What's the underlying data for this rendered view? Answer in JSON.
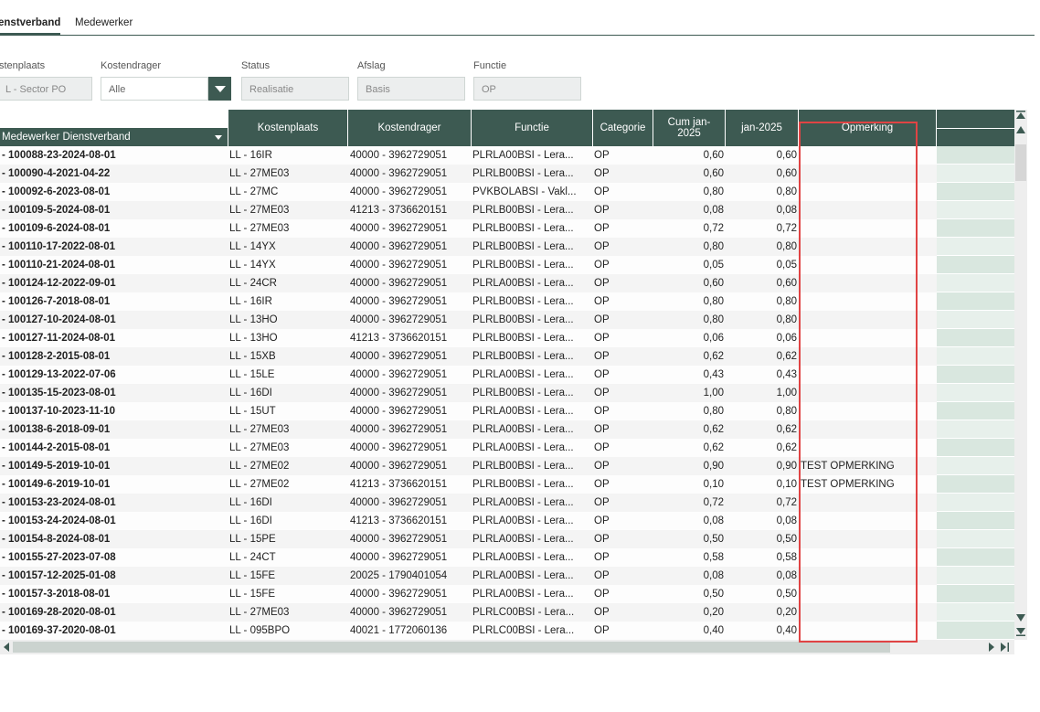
{
  "tabs": {
    "active": "enstverband",
    "second": "Medewerker"
  },
  "filters": [
    {
      "label": "stenplaats",
      "value": "L - Sector PO"
    },
    {
      "label": "Kostendrager",
      "value": "Alle"
    },
    {
      "label": "Status",
      "value": "Realisatie"
    },
    {
      "label": "Afslag",
      "value": "Basis"
    },
    {
      "label": "Functie",
      "value": "OP"
    }
  ],
  "table": {
    "headers": {
      "col1": "Medewerker Dienstverband",
      "col2": "Kostenplaats",
      "col3": "Kostendrager",
      "col4": "Functie",
      "col5": "Categorie",
      "col6": "Cum jan-\n2025",
      "col7": "jan-2025",
      "col8": "Opmerking"
    },
    "rows": [
      [
        "- 100088-23-2024-08-01",
        "LL - 16IR",
        "40000 - 3962729051",
        "PLRLA00BSI - Lera...",
        "OP",
        "0,60",
        "0,60",
        ""
      ],
      [
        "- 100090-4-2021-04-22",
        "LL - 27ME03",
        "40000 - 3962729051",
        "PLRLB00BSI - Lera...",
        "OP",
        "0,60",
        "0,60",
        ""
      ],
      [
        "- 100092-6-2023-08-01",
        "LL - 27MC",
        "40000 - 3962729051",
        "PVKBOLABSI - Vakl...",
        "OP",
        "0,80",
        "0,80",
        ""
      ],
      [
        "- 100109-5-2024-08-01",
        "LL - 27ME03",
        "41213 - 3736620151",
        "PLRLB00BSI - Lera...",
        "OP",
        "0,08",
        "0,08",
        ""
      ],
      [
        "- 100109-6-2024-08-01",
        "LL - 27ME03",
        "40000 - 3962729051",
        "PLRLB00BSI - Lera...",
        "OP",
        "0,72",
        "0,72",
        ""
      ],
      [
        "- 100110-17-2022-08-01",
        "LL - 14YX",
        "40000 - 3962729051",
        "PLRLB00BSI - Lera...",
        "OP",
        "0,80",
        "0,80",
        ""
      ],
      [
        "- 100110-21-2024-08-01",
        "LL - 14YX",
        "40000 - 3962729051",
        "PLRLB00BSI - Lera...",
        "OP",
        "0,05",
        "0,05",
        ""
      ],
      [
        "- 100124-12-2022-09-01",
        "LL - 24CR",
        "40000 - 3962729051",
        "PLRLA00BSI - Lera...",
        "OP",
        "0,60",
        "0,60",
        ""
      ],
      [
        "- 100126-7-2018-08-01",
        "LL - 16IR",
        "40000 - 3962729051",
        "PLRLB00BSI - Lera...",
        "OP",
        "0,80",
        "0,80",
        ""
      ],
      [
        "- 100127-10-2024-08-01",
        "LL - 13HO",
        "40000 - 3962729051",
        "PLRLB00BSI - Lera...",
        "OP",
        "0,80",
        "0,80",
        ""
      ],
      [
        "- 100127-11-2024-08-01",
        "LL - 13HO",
        "41213 - 3736620151",
        "PLRLB00BSI - Lera...",
        "OP",
        "0,06",
        "0,06",
        ""
      ],
      [
        "- 100128-2-2015-08-01",
        "LL - 15XB",
        "40000 - 3962729051",
        "PLRLB00BSI - Lera...",
        "OP",
        "0,62",
        "0,62",
        ""
      ],
      [
        "- 100129-13-2022-07-06",
        "LL - 15LE",
        "40000 - 3962729051",
        "PLRLA00BSI - Lera...",
        "OP",
        "0,43",
        "0,43",
        ""
      ],
      [
        "- 100135-15-2023-08-01",
        "LL - 16DI",
        "40000 - 3962729051",
        "PLRLB00BSI - Lera...",
        "OP",
        "1,00",
        "1,00",
        ""
      ],
      [
        "- 100137-10-2023-11-10",
        "LL - 15UT",
        "40000 - 3962729051",
        "PLRLA00BSI - Lera...",
        "OP",
        "0,80",
        "0,80",
        ""
      ],
      [
        "- 100138-6-2018-09-01",
        "LL - 27ME03",
        "40000 - 3962729051",
        "PLRLA00BSI - Lera...",
        "OP",
        "0,62",
        "0,62",
        ""
      ],
      [
        "- 100144-2-2015-08-01",
        "LL - 27ME03",
        "40000 - 3962729051",
        "PLRLA00BSI - Lera...",
        "OP",
        "0,62",
        "0,62",
        ""
      ],
      [
        "- 100149-5-2019-10-01",
        "LL - 27ME02",
        "40000 - 3962729051",
        "PLRLB00BSI - Lera...",
        "OP",
        "0,90",
        "0,90",
        "TEST OPMERKING"
      ],
      [
        "- 100149-6-2019-10-01",
        "LL - 27ME02",
        "41213 - 3736620151",
        "PLRLB00BSI - Lera...",
        "OP",
        "0,10",
        "0,10",
        "TEST OPMERKING"
      ],
      [
        "- 100153-23-2024-08-01",
        "LL - 16DI",
        "40000 - 3962729051",
        "PLRLA00BSI - Lera...",
        "OP",
        "0,72",
        "0,72",
        ""
      ],
      [
        "- 100153-24-2024-08-01",
        "LL - 16DI",
        "41213 - 3736620151",
        "PLRLA00BSI - Lera...",
        "OP",
        "0,08",
        "0,08",
        ""
      ],
      [
        "- 100154-8-2024-08-01",
        "LL - 15PE",
        "40000 - 3962729051",
        "PLRLA00BSI - Lera...",
        "OP",
        "0,50",
        "0,50",
        ""
      ],
      [
        "- 100155-27-2023-07-08",
        "LL - 24CT",
        "40000 - 3962729051",
        "PLRLA00BSI - Lera...",
        "OP",
        "0,58",
        "0,58",
        ""
      ],
      [
        "- 100157-12-2025-01-08",
        "LL - 15FE",
        "20025 - 1790401054",
        "PLRLA00BSI - Lera...",
        "OP",
        "0,08",
        "0,08",
        ""
      ],
      [
        "- 100157-3-2018-08-01",
        "LL - 15FE",
        "40000 - 3962729051",
        "PLRLA00BSI - Lera...",
        "OP",
        "0,50",
        "0,50",
        ""
      ],
      [
        "- 100169-28-2020-08-01",
        "LL - 27ME03",
        "40000 - 3962729051",
        "PLRLC00BSI - Lera...",
        "OP",
        "0,20",
        "0,20",
        ""
      ],
      [
        "- 100169-37-2020-08-01",
        "LL - 095BPO",
        "40021 - 1772060136",
        "PLRLC00BSI - Lera...",
        "OP",
        "0,40",
        "0,40",
        ""
      ]
    ]
  }
}
